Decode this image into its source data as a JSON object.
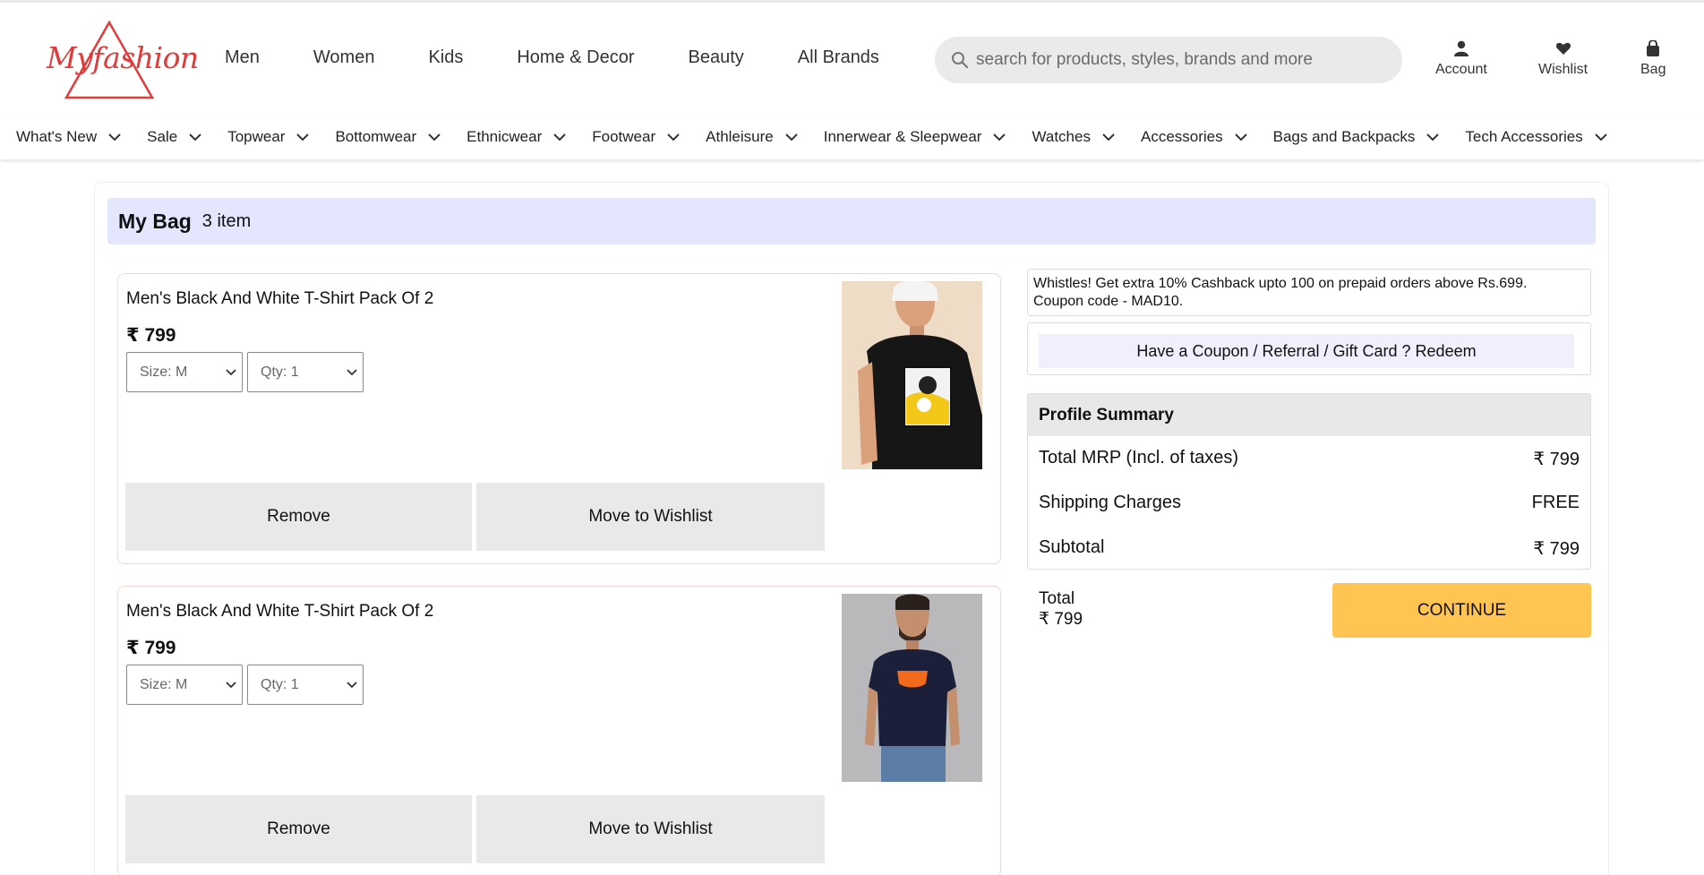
{
  "brand": {
    "logo_text": "Myfashion",
    "accent": "#e03b3b"
  },
  "main_nav": [
    "Men",
    "Women",
    "Kids",
    "Home & Decor",
    "Beauty",
    "All Brands"
  ],
  "search": {
    "placeholder": "search for products, styles, brands and more"
  },
  "header_actions": {
    "account": "Account",
    "wishlist": "Wishlist",
    "bag": "Bag"
  },
  "categories": [
    "What's New",
    "Sale",
    "Topwear",
    "Bottomwear",
    "Ethnicwear",
    "Footwear",
    "Athleisure",
    "Innerwear & Sleepwear",
    "Watches",
    "Accessories",
    "Bags and Backpacks",
    "Tech Accessories"
  ],
  "bag": {
    "title": "My Bag",
    "count": "3 item"
  },
  "items": [
    {
      "name": "Men's Black And White T-Shirt Pack Of 2",
      "price": "₹ 799",
      "size": "Size: M",
      "qty": "Qty: 1",
      "remove": "Remove",
      "wishlist": "Move to Wishlist"
    },
    {
      "name": "Men's Black And White T-Shirt Pack Of 2",
      "price": "₹ 799",
      "size": "Size: M",
      "qty": "Qty: 1",
      "remove": "Remove",
      "wishlist": "Move to Wishlist"
    }
  ],
  "promo": {
    "line1": "Whistles! Get extra 10% Cashback upto 100 on prepaid orders above Rs.699.",
    "line2": "Coupon code - MAD10."
  },
  "coupon": {
    "label": "Have a Coupon / Referral / Gift Card ? Redeem"
  },
  "summary": {
    "title": "Profile Summary",
    "rows": [
      {
        "label": "Total MRP (Incl. of taxes)",
        "value": "₹ 799"
      },
      {
        "label": "Shipping Charges",
        "value": "FREE"
      },
      {
        "label": "Subtotal",
        "value": "₹ 799"
      }
    ]
  },
  "total": {
    "label": "Total",
    "value": "₹ 799"
  },
  "continue_label": "CONTINUE",
  "colors": {
    "bag_header_bg": "#e3e6fd",
    "continue_bg": "#ffc451",
    "button_gray": "#e9e9e9"
  }
}
